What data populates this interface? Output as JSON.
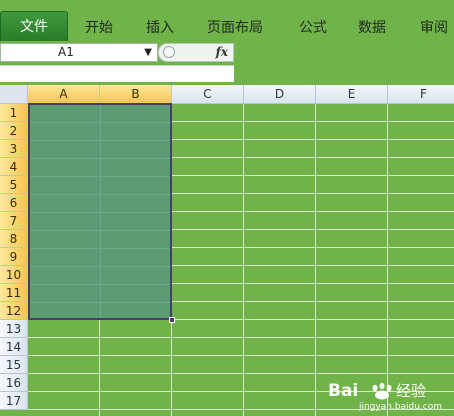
{
  "ribbon": {
    "file_tab": "文件",
    "tabs": [
      "开始",
      "插入",
      "页面布局",
      "公式",
      "数据",
      "审阅"
    ]
  },
  "formula_bar": {
    "name_box": "A1",
    "fx_label": "fx",
    "formula": ""
  },
  "sheet": {
    "columns": [
      "A",
      "B",
      "C",
      "D",
      "E",
      "F"
    ],
    "rows": [
      "1",
      "2",
      "3",
      "4",
      "5",
      "6",
      "7",
      "8",
      "9",
      "10",
      "11",
      "12",
      "13",
      "14",
      "15",
      "16",
      "17"
    ],
    "selected_range": "A1:B12",
    "selected_columns": [
      "A",
      "B"
    ],
    "selected_rows_count": 12
  },
  "colors": {
    "background": "#70b348",
    "selection_fill": "#5c9b74",
    "selection_border": "#4b3a6e",
    "header_selected": "#f5c552"
  },
  "watermark": {
    "brand": "Bai",
    "brand2": "经验",
    "url": "jingyan.baidu.com"
  }
}
